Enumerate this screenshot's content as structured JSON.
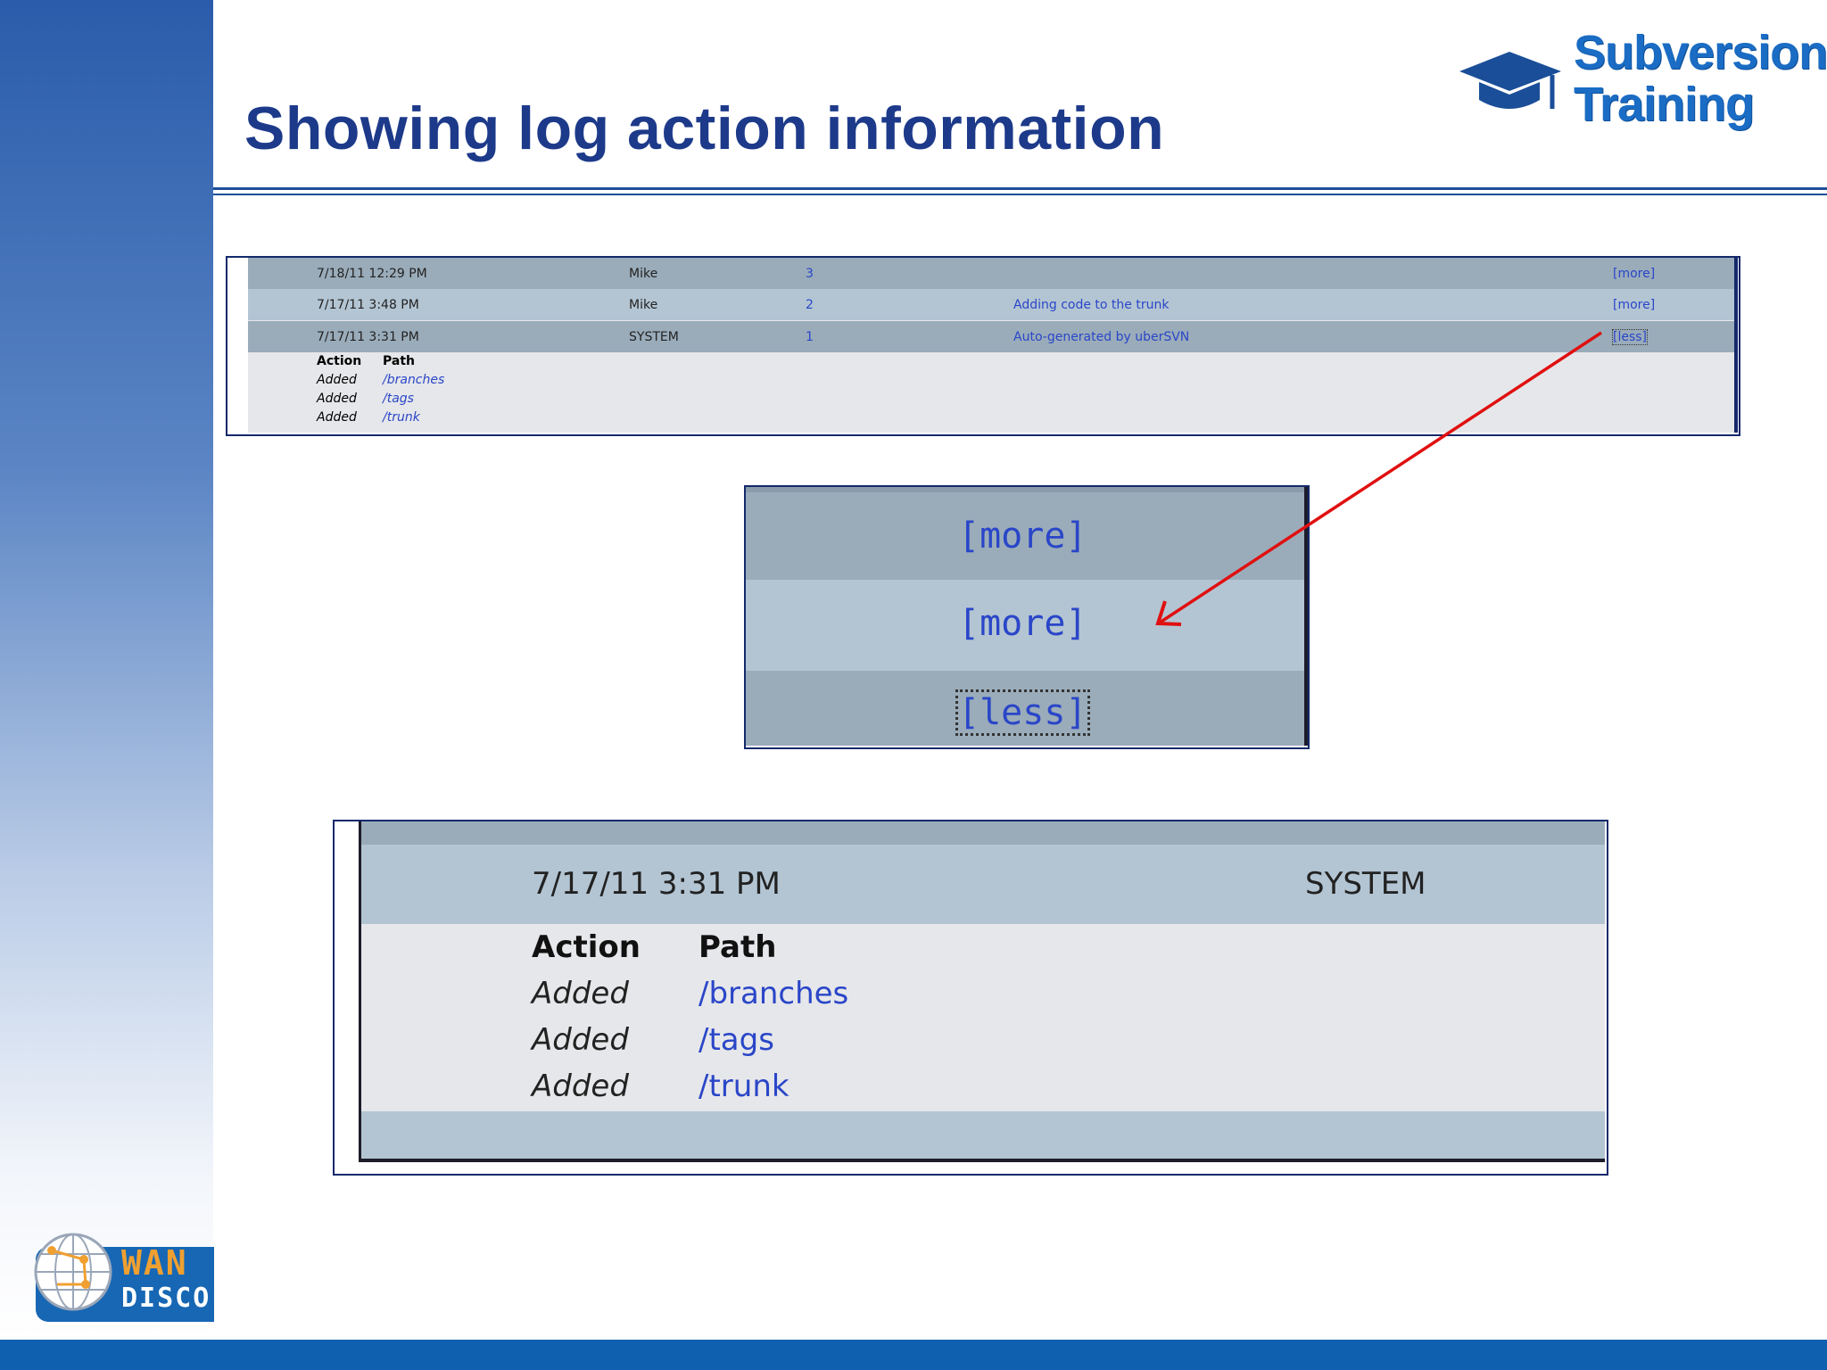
{
  "slide": {
    "title": "Showing log action information"
  },
  "brand": {
    "line1": "Subversion",
    "line2": "Training",
    "icon": "graduation-cap-icon"
  },
  "logo": {
    "line1": "WAN",
    "line2": "DISCO",
    "icon": "globe-icon"
  },
  "log_table": {
    "rows": [
      {
        "date": "7/18/11 12:29 PM",
        "author": "Mike",
        "revision": "3",
        "message": "",
        "toggle": "[more]"
      },
      {
        "date": "7/17/11 3:48 PM",
        "author": "Mike",
        "revision": "2",
        "message": "Adding code to the trunk",
        "toggle": "[more]"
      },
      {
        "date": "7/17/11 3:31 PM",
        "author": "SYSTEM",
        "revision": "1",
        "message": "Auto-generated by uberSVN",
        "toggle": "[less]"
      }
    ],
    "detail": {
      "action_header": "Action",
      "path_header": "Path",
      "entries": [
        {
          "action": "Added",
          "path": "/branches"
        },
        {
          "action": "Added",
          "path": "/tags"
        },
        {
          "action": "Added",
          "path": "/trunk"
        }
      ]
    }
  },
  "zoom_toggles": {
    "items": [
      "[more]",
      "[more]",
      "[less]"
    ]
  },
  "zoom_detail": {
    "date": "7/17/11 3:31 PM",
    "author": "SYSTEM",
    "action_header": "Action",
    "path_header": "Path",
    "entries": [
      {
        "action": "Added",
        "path": "/branches"
      },
      {
        "action": "Added",
        "path": "/tags"
      },
      {
        "action": "Added",
        "path": "/trunk"
      }
    ]
  },
  "colors": {
    "title": "#1d3a8a",
    "row_dark": "#9aacba",
    "row_light": "#b3c5d3",
    "detail_bg": "#e6e7ea",
    "link": "#2a46c8",
    "arrow": "#e01010",
    "footer": "#1060b0"
  }
}
